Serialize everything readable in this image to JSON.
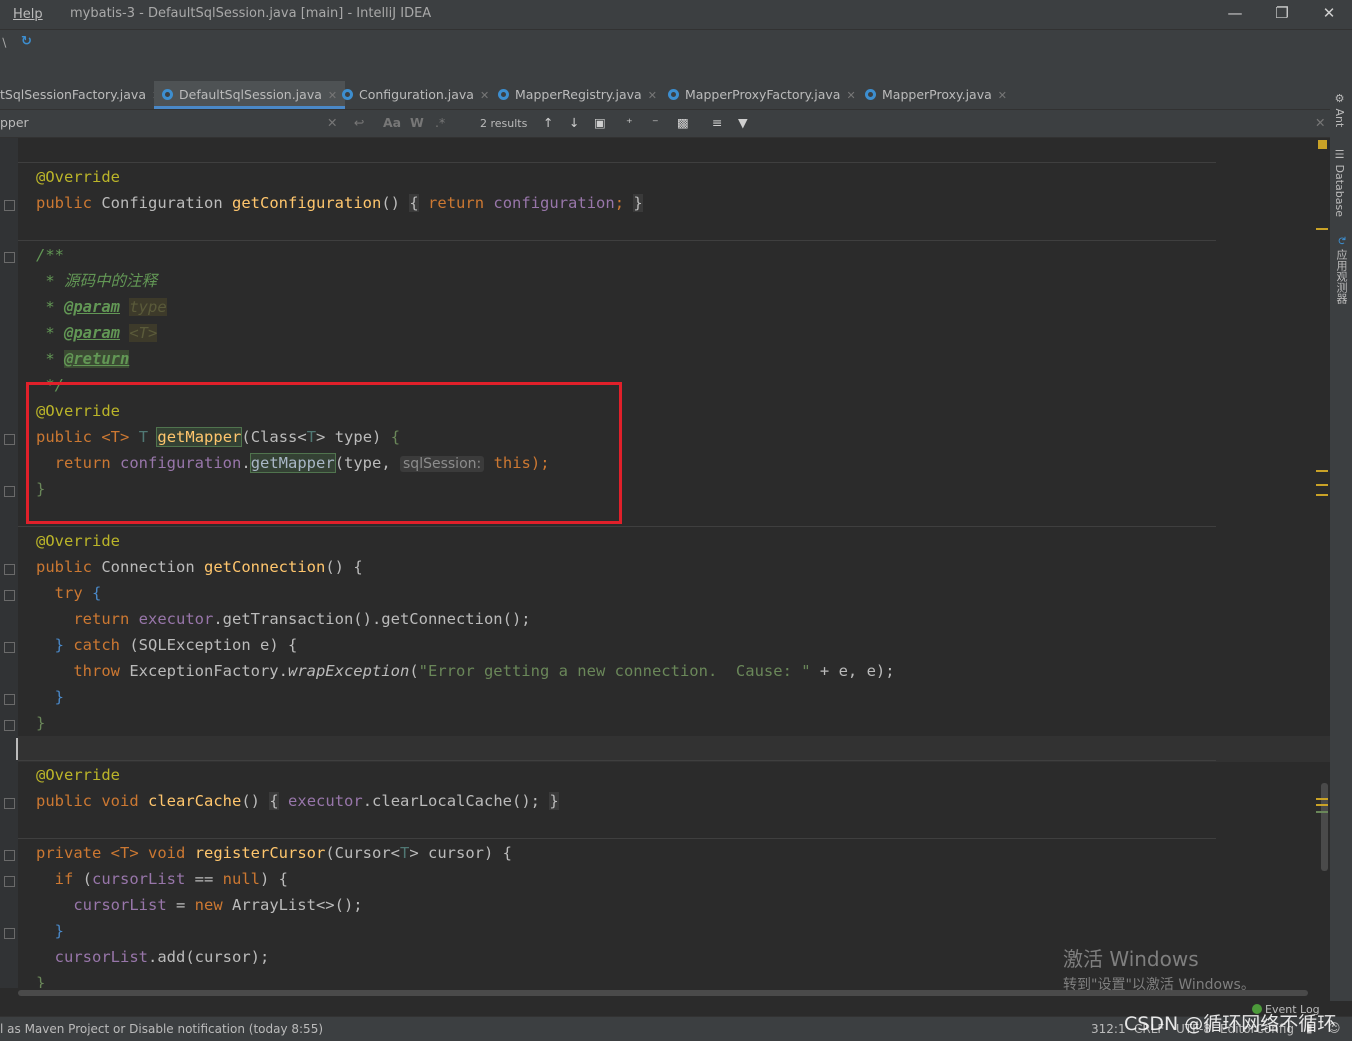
{
  "window": {
    "menu_help": "Help",
    "title": "mybatis-3 - DefaultSqlSession.java [main] - IntelliJ IDEA"
  },
  "tabs": [
    {
      "label": "tSqlSessionFactory.java"
    },
    {
      "label": "DefaultSqlSession.java",
      "active": true
    },
    {
      "label": "Configuration.java"
    },
    {
      "label": "MapperRegistry.java"
    },
    {
      "label": "MapperProxyFactory.java"
    },
    {
      "label": "MapperProxy.java"
    }
  ],
  "find": {
    "query": "pper",
    "match_case": "Aa",
    "words": "W",
    "regex": ".*",
    "results": "2 results"
  },
  "code": {
    "o1_ann": "@Override",
    "o1_l1": "public",
    "o1_l2": "Configuration",
    "o1_l3": "getConfiguration",
    "o1_l4": "()",
    "o1_l5": "{",
    "o1_l6": "return",
    "o1_l7": "configuration",
    "o1_l8": ";",
    "o1_l9": "}",
    "d_open": "/**",
    "d_l1": " * 源码中的注释",
    "d_star": " * ",
    "d_param": "@param",
    "d_type": "type",
    "d_t": "<T>",
    "d_return": "@return",
    "d_close": " */",
    "g_ann": "@Override",
    "g_public": "public",
    "g_tgen": "<T>",
    "g_T": "T",
    "g_name": "getMapper",
    "g_args1": "(Class<",
    "g_args2": "T",
    "g_args3": "> type) ",
    "g_brace": "{",
    "g_return": "return",
    "g_cfg": "configuration",
    "g_dot": ".",
    "g_call": "getMapper",
    "g_a1": "(type, ",
    "g_hint": "sqlSession:",
    "g_this": "this",
    "g_end": ");",
    "g_close": "}",
    "c_ann": "@Override",
    "c_l1a": "public",
    "c_l1b": "Connection",
    "c_l1c": "getConnection",
    "c_l1d": "() {",
    "c_try": "try",
    "c_ob": " {",
    "c_ret": "return",
    "c_exec": "executor",
    "c_rest": ".getTransaction().getConnection();",
    "c_cb": "} ",
    "c_catch": "catch",
    "c_catchrest": " (SQLException e) {",
    "c_throw": "throw",
    "c_ef": " ExceptionFactory.",
    "c_wrap": "wrapException",
    "c_p1": "(",
    "c_str": "\"Error getting a new connection.  Cause: \"",
    "c_p2": " + e, e);",
    "c_in_close": "}",
    "c_close": "}",
    "cc_ann": "@Override",
    "cc_pub": "public",
    "cc_void": "void",
    "cc_name": "clearCache",
    "cc_pr": "()",
    "cc_ob": "{",
    "cc_exec": "executor",
    "cc_call": ".clearLocalCache();",
    "cc_cb": "}",
    "r_priv": "private",
    "r_t": "<T>",
    "r_void": "void",
    "r_name": "registerCursor",
    "r_args": "(Cursor<",
    "r_t2": "T",
    "r_args2": "> cursor) {",
    "r_if": "if",
    "r_cond1": " (",
    "r_cl": "cursorList",
    "r_cond2": " == ",
    "r_null": "null",
    "r_cond3": ") {",
    "r_cl2": "cursorList",
    "r_assign": " = ",
    "r_new": "new",
    "r_arr": " ArrayList<>();",
    "r_ib": "}",
    "r_cl3": "cursorList",
    "r_add": ".add(cursor);",
    "r_close": "}"
  },
  "right_tools": {
    "ant": "Ant",
    "database": "Database",
    "app": "应用观测器"
  },
  "status": {
    "notification": "l as Maven Project or Disable notification (today 8:55)",
    "position": "312:1",
    "crlf": "CRLF",
    "encoding": "UTF-8",
    "editorconfig": "EditorConfig",
    "event_log": "Event Log",
    "csdn": "CSDN @循环网络不循环"
  },
  "watermark": {
    "line1": "激活 Windows",
    "line2": "转到\"设置\"以激活 Windows。"
  }
}
